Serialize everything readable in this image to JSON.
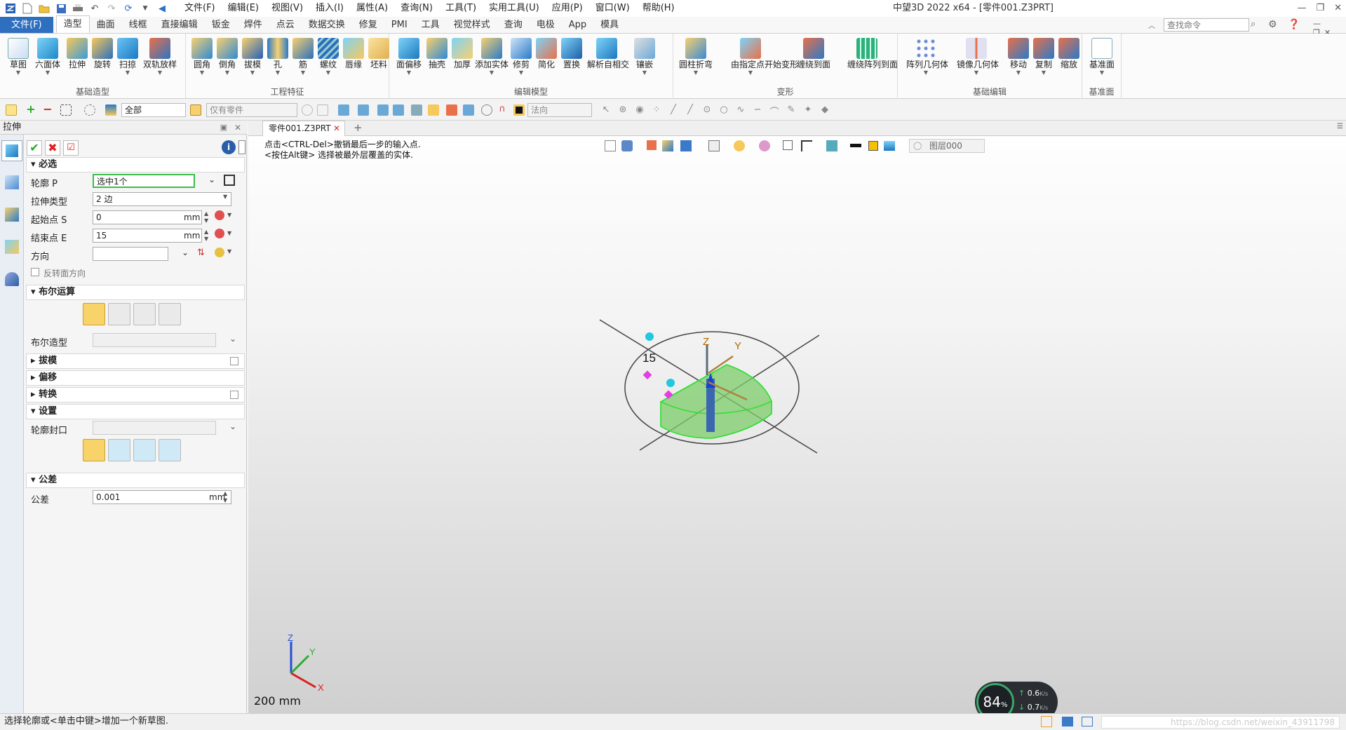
{
  "window": {
    "title": "中望3D 2022 x64 - [零件001.Z3PRT]"
  },
  "menu": [
    "文件(F)",
    "编辑(E)",
    "视图(V)",
    "插入(I)",
    "属性(A)",
    "查询(N)",
    "工具(T)",
    "实用工具(U)",
    "应用(P)",
    "窗口(W)",
    "帮助(H)"
  ],
  "ribbon_tabs": [
    "文件(F)",
    "造型",
    "曲面",
    "线框",
    "直接编辑",
    "钣金",
    "焊件",
    "点云",
    "数据交换",
    "修复",
    "PMI",
    "工具",
    "视觉样式",
    "查询",
    "电极",
    "App",
    "模具"
  ],
  "search_placeholder": "查找命令",
  "ribbon_groups": [
    {
      "label": "基础造型",
      "tools": [
        "草图",
        "六面体",
        "拉伸",
        "旋转",
        "扫掠",
        "双轨放样"
      ]
    },
    {
      "label": "工程特征",
      "tools": [
        "圆角",
        "倒角",
        "拔模",
        "孔",
        "筋",
        "螺纹",
        "唇缘",
        "坯料"
      ]
    },
    {
      "label": "编辑模型",
      "tools": [
        "面偏移",
        "抽壳",
        "加厚",
        "添加实体",
        "修剪",
        "简化",
        "置换",
        "解析自相交",
        "镶嵌"
      ]
    },
    {
      "label": "变形",
      "tools": [
        "圆柱折弯",
        "由指定点开始变形",
        "缠绕到面",
        "缠绕阵列到面"
      ]
    },
    {
      "label": "基础编辑",
      "tools": [
        "阵列几何体",
        "镜像几何体",
        "移动",
        "复制",
        "缩放"
      ]
    },
    {
      "label": "基准面",
      "tools": [
        "基准面"
      ]
    }
  ],
  "options_bar": {
    "filter": "全部",
    "part": "仅有零件",
    "direction": "法向",
    "layer": "图层000"
  },
  "panel": {
    "title": "拉伸",
    "sections": {
      "required": "必选",
      "boolean": "布尔运算",
      "draft": "拔模",
      "offset": "偏移",
      "transform": "转换",
      "settings": "设置",
      "tolerance": "公差"
    },
    "profile_label": "轮廓 P",
    "profile_value": "选中1个",
    "type_label": "拉伸类型",
    "type_value": "2 边",
    "start_label": "起始点 S",
    "start_value": "0",
    "start_unit": "mm",
    "end_label": "结束点 E",
    "end_value": "15",
    "end_unit": "mm",
    "dir_label": "方向",
    "flip_label": "反转面方向",
    "bool_shape_label": "布尔造型",
    "profile_cap_label": "轮廓封口",
    "tol_label": "公差",
    "tol_value": "0.001",
    "tol_unit": "mm"
  },
  "doc_tab": "零件001.Z3PRT",
  "hint_lines": [
    "点击<CTRL-Del>撤销最后一步的输入点.",
    "<按住Alt键> 选择被最外层覆盖的实体."
  ],
  "dimension_label": "15",
  "axis": {
    "x": "X",
    "y": "Y",
    "z": "Z"
  },
  "scale_label": "200 mm",
  "perf": {
    "percent": "84",
    "unit": "%",
    "up": "0.6",
    "down": "0.7",
    "rate_unit": "K/s"
  },
  "status": "选择轮廓或<单击中键>增加一个新草图.",
  "watermark": "https://blog.csdn.net/weixin_43911798"
}
